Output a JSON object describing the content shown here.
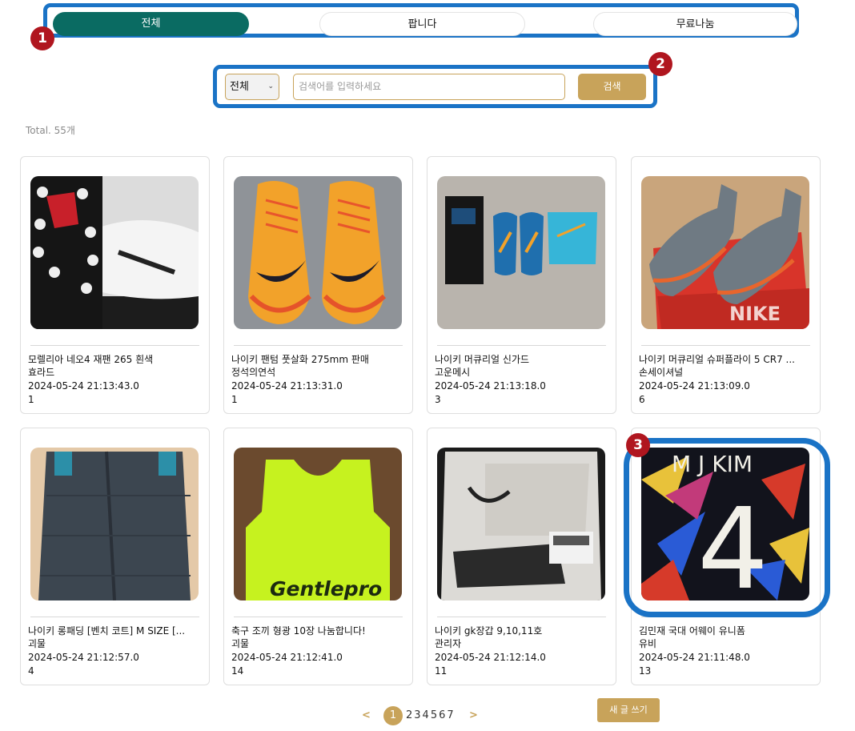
{
  "tabs": [
    {
      "label": "전체",
      "active": true
    },
    {
      "label": "팝니다",
      "active": false
    },
    {
      "label": "무료나눔",
      "active": false
    }
  ],
  "markers": [
    "1",
    "2",
    "3"
  ],
  "search": {
    "select_value": "전체",
    "placeholder": "검색어를 입력하세요",
    "button_label": "검색"
  },
  "total_label": "Total. 55개",
  "posts": [
    {
      "title": "모렐리아 네오4 재팬 265 흰색",
      "author": "효라드",
      "date": "2024-05-24 21:13:43.0",
      "views": "1"
    },
    {
      "title": "나이키 팬텀 풋살화 275mm 판매",
      "author": "정석의연석",
      "date": "2024-05-24 21:13:31.0",
      "views": "1"
    },
    {
      "title": "나이키 머큐리얼 신가드",
      "author": "고운메시",
      "date": "2024-05-24 21:13:18.0",
      "views": "3"
    },
    {
      "title": "나이키 머큐리얼 슈퍼플라이 5 CR7 ...",
      "author": "손세이셔널",
      "date": "2024-05-24 21:13:09.0",
      "views": "6"
    },
    {
      "title": "나이키 롱패딩 [벤치 코트] M SIZE [...",
      "author": "괴물",
      "date": "2024-05-24 21:12:57.0",
      "views": "4"
    },
    {
      "title": "축구 조끼 형광 10장 나눔합니다!",
      "author": "괴물",
      "date": "2024-05-24 21:12:41.0",
      "views": "14"
    },
    {
      "title": "나이키 gk장갑 9,10,11호",
      "author": "관리자",
      "date": "2024-05-24 21:12:14.0",
      "views": "11"
    },
    {
      "title": "김민재 국대 어웨이 유니폼",
      "author": "유비",
      "date": "2024-05-24 21:11:48.0",
      "views": "13"
    }
  ],
  "photo_text": {
    "bib_brand": "Gentlepro",
    "jersey_name": "M J KIM",
    "jersey_number": "4",
    "box_brand": "NIKE"
  },
  "pagination": {
    "prev": "<",
    "current": "1",
    "pages": "234567",
    "next": ">"
  },
  "new_post_label": "새 글 쓰기",
  "colors": {
    "accent_gold": "#c8a35a",
    "tab_active": "#0a6b62",
    "annotation_blue": "#1a73c6",
    "annotation_red": "#b0161f"
  }
}
